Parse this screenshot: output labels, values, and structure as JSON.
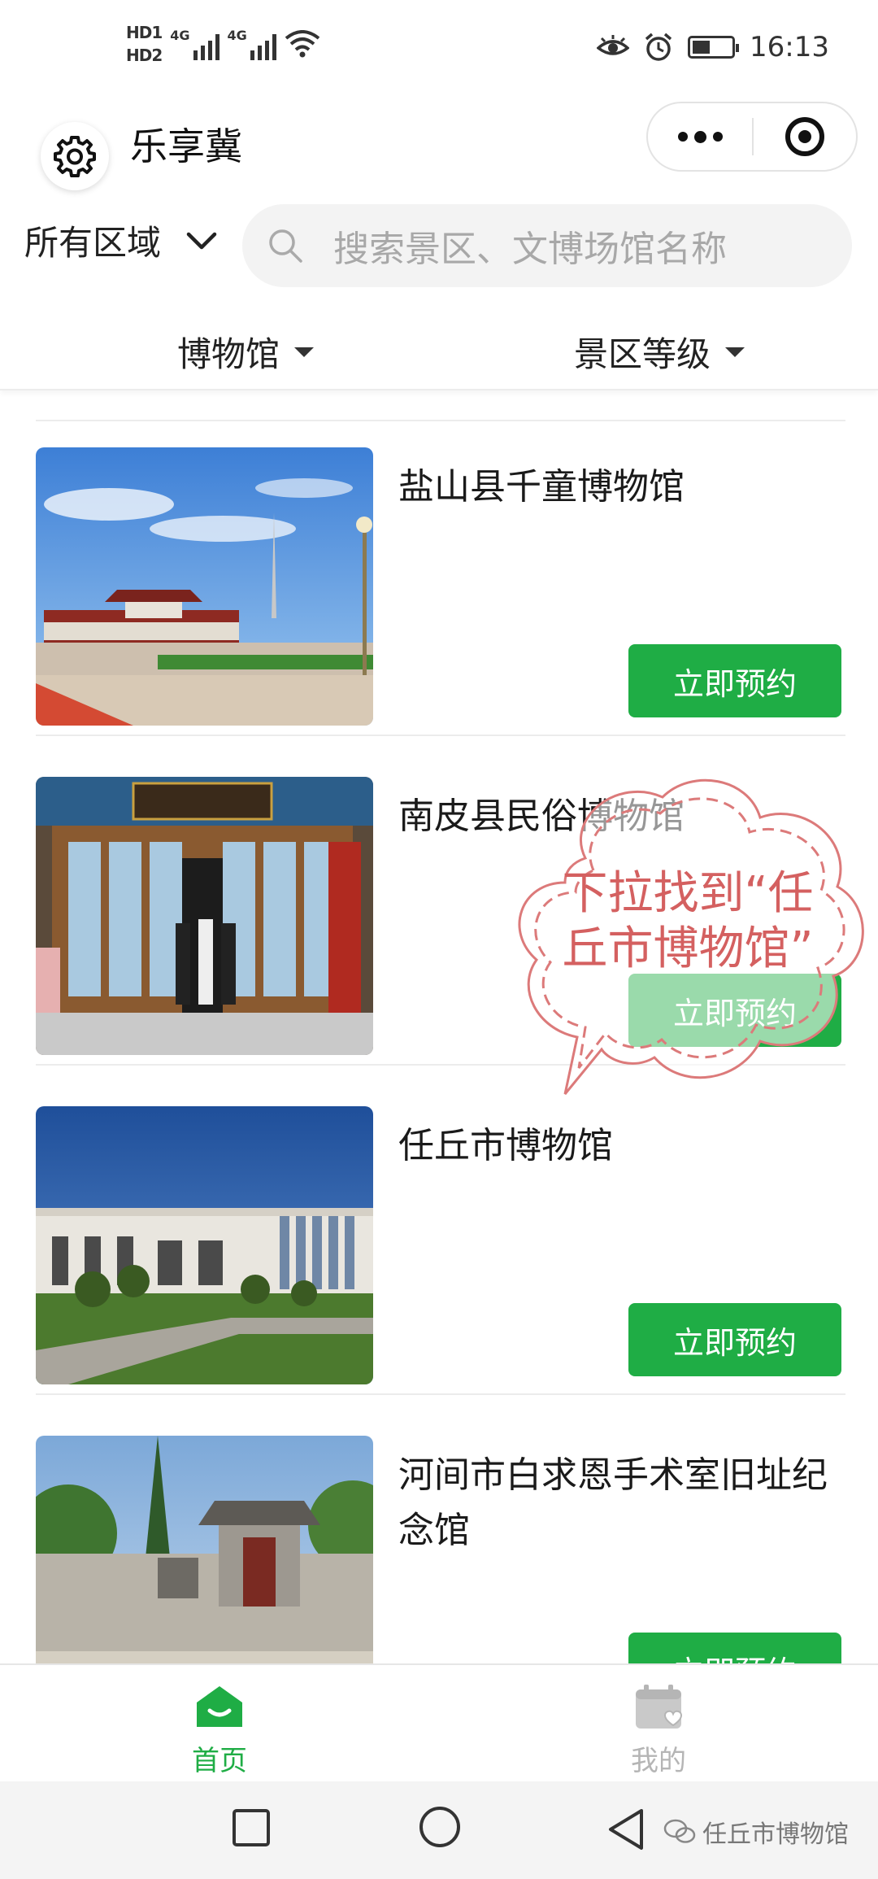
{
  "status_bar": {
    "hd1": "HD1",
    "hd2": "HD2",
    "net1": "4G",
    "net2": "4G",
    "time": "16:13",
    "battery_level": 0.45
  },
  "title_bar": {
    "app_title": "乐享冀",
    "logo_icon": "gear-icon",
    "more_icon": "more-dots-icon",
    "close_icon": "target-icon"
  },
  "search": {
    "region_label": "所有区域",
    "placeholder": "搜索景区、文博场馆名称"
  },
  "filters": [
    {
      "label": "博物馆"
    },
    {
      "label": "景区等级"
    }
  ],
  "venues": [
    {
      "name": "盐山县千童博物馆",
      "button": "立即预约"
    },
    {
      "name": "南皮县民俗博物馆",
      "button": "立即预约"
    },
    {
      "name": "任丘市博物馆",
      "button": "立即预约"
    },
    {
      "name": "河间市白求恩手术室旧址纪念馆",
      "button": "立即预约"
    }
  ],
  "annotation": {
    "text": "下拉找到“任丘市博物馆”"
  },
  "tabs": [
    {
      "label": "首页",
      "icon": "home-icon",
      "active": true
    },
    {
      "label": "我的",
      "icon": "calendar-heart-icon",
      "active": false
    }
  ],
  "watermark": {
    "text": "任丘市博物馆"
  },
  "colors": {
    "accent": "#1fad45",
    "tab_active": "#1fad45",
    "tab_inactive": "#b5b5b5",
    "annotation": "#d46060"
  }
}
